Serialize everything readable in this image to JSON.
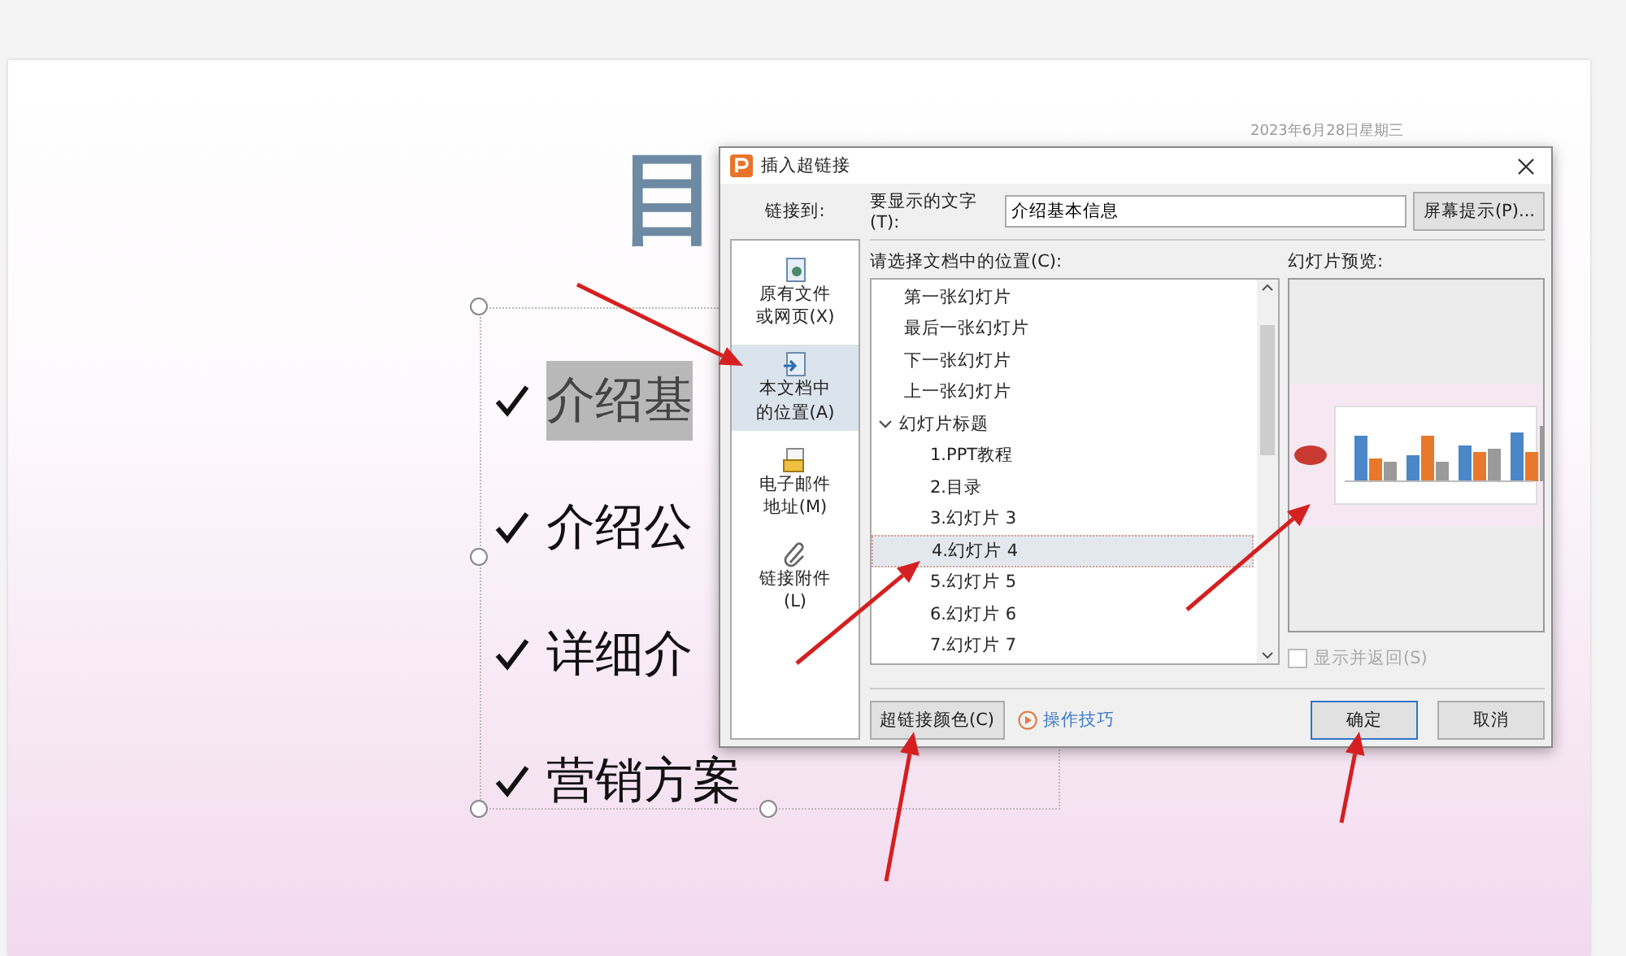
{
  "slide": {
    "title": "目",
    "date": "2023年6月28日星期三",
    "bullets": [
      {
        "text": "介绍基",
        "highlighted": true
      },
      {
        "text": "介绍公",
        "highlighted": false
      },
      {
        "text": "详细介",
        "highlighted": false
      },
      {
        "text": "营销方案",
        "highlighted": false
      }
    ]
  },
  "dialog": {
    "title": "插入超链接",
    "link_to_label": "链接到:",
    "display_text_label": "要显示的文字(T):",
    "display_text_value": "介绍基本信息",
    "screen_tip_button": "屏幕提示(P)...",
    "link_targets": [
      {
        "label": "原有文件或网页(X)",
        "kind": "file",
        "selected": false
      },
      {
        "label": "本文档中的位置(A)",
        "kind": "place",
        "selected": true
      },
      {
        "label": "电子邮件地址(M)",
        "kind": "email",
        "selected": false
      },
      {
        "label": "链接附件(L)",
        "kind": "attach",
        "selected": false
      }
    ],
    "location_label": "请选择文档中的位置(C):",
    "locations": [
      {
        "label": "第一张幻灯片",
        "selected": false
      },
      {
        "label": "最后一张幻灯片",
        "selected": false
      },
      {
        "label": "下一张幻灯片",
        "selected": false
      },
      {
        "label": "上一张幻灯片",
        "selected": false
      },
      {
        "label": "幻灯片标题",
        "selected": false,
        "expanded": true,
        "children": [
          {
            "label": "1.PPT教程",
            "selected": false
          },
          {
            "label": "2.目录",
            "selected": false
          },
          {
            "label": "3.幻灯片 3",
            "selected": false
          },
          {
            "label": "4.幻灯片 4",
            "selected": true
          },
          {
            "label": "5.幻灯片 5",
            "selected": false
          },
          {
            "label": "6.幻灯片 6",
            "selected": false
          },
          {
            "label": "7.幻灯片 7",
            "selected": false
          }
        ]
      }
    ],
    "preview_label": "幻灯片预览:",
    "show_and_return": {
      "label": "显示并返回(S)",
      "checked": false,
      "disabled": true
    },
    "color_button": "超链接颜色(C)",
    "tips_link": "操作技巧",
    "ok_button": "确定",
    "cancel_button": "取消"
  }
}
